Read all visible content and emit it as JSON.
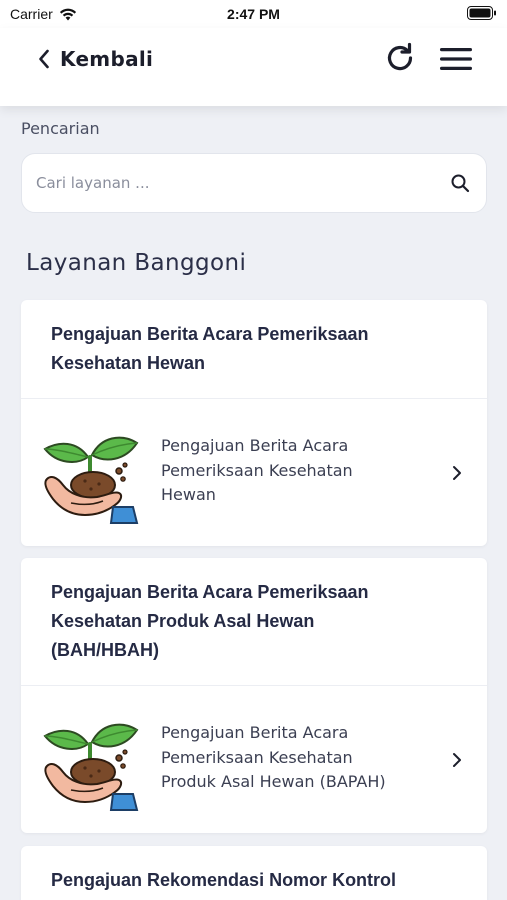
{
  "status_bar": {
    "carrier": "Carrier",
    "time": "2:47 PM"
  },
  "header": {
    "back_label": "Kembali",
    "icons": [
      "chevron-left-icon",
      "refresh-icon",
      "hamburger-menu-icon"
    ]
  },
  "search": {
    "label": "Pencarian",
    "placeholder": "Cari layanan ..."
  },
  "section_title": "Layanan Banggoni",
  "cards": [
    {
      "title_lines": [
        "Pengajuan Berita Acara Pemeriksaan",
        "Kesehatan Hewan"
      ],
      "item_lines": [
        "Pengajuan Berita Acara",
        "Pemeriksaan Kesehatan",
        "Hewan"
      ]
    },
    {
      "title_lines": [
        "Pengajuan Berita Acara Pemeriksaan",
        "Kesehatan Produk Asal Hewan",
        "(BAH/HBAH)"
      ],
      "item_lines": [
        "Pengajuan Berita Acara",
        "Pemeriksaan Kesehatan",
        "Produk Asal Hewan (BAPAH)"
      ]
    },
    {
      "title_lines": [
        "Pengajuan Rekomendasi Nomor Kontrol"
      ]
    }
  ],
  "colors": {
    "background": "#eef0f5",
    "card": "#ffffff",
    "text_dark": "#252a44",
    "leaf_green": "#5bb94a",
    "soil_brown": "#7a4a2a"
  }
}
